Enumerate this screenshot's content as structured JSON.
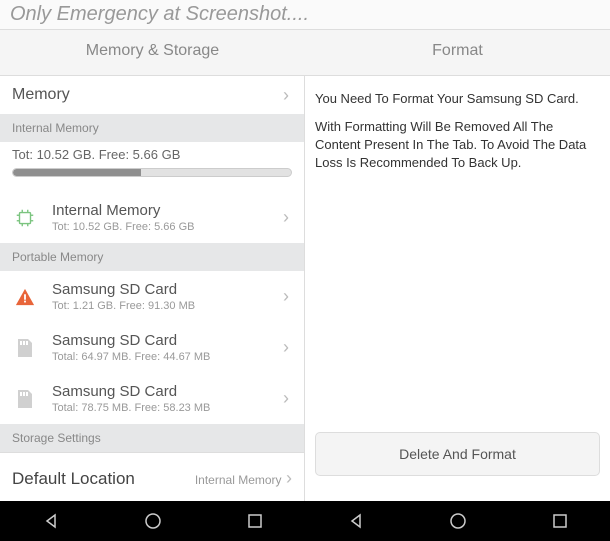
{
  "top_status": "Only Emergency at Screenshot....",
  "tabs": {
    "memory": "Memory & Storage",
    "format": "Format"
  },
  "left": {
    "memory_label": "Memory",
    "internal_header": "Internal Memory",
    "total_free": "Tot: 10.52 GB. Free: 5.66 GB",
    "items": [
      {
        "title": "Internal Memory",
        "sub": "Tot: 10.52 GB. Free: 5.66 GB"
      },
      {
        "header": "Portable Memory"
      },
      {
        "title": "Samsung SD Card",
        "sub": "Tot: 1.21 GB. Free: 91.30 MB",
        "warn": true
      },
      {
        "title": "Samsung SD Card",
        "sub": "Total: 64.97 MB. Free: 44.67 MB"
      },
      {
        "title": "Samsung SD Card",
        "sub": "Total: 78.75 MB. Free: 58.23 MB"
      }
    ],
    "settings_header": "Storage Settings",
    "default_loc_label": "Default Location",
    "default_loc_val": "Internal Memory"
  },
  "right": {
    "line1": "You Need To Format Your Samsung SD Card.",
    "line2": "With Formatting Will Be Removed All The Content Present In The Tab. To Avoid The Data Loss Is Recommended To Back Up.",
    "button": "Delete And Format"
  }
}
